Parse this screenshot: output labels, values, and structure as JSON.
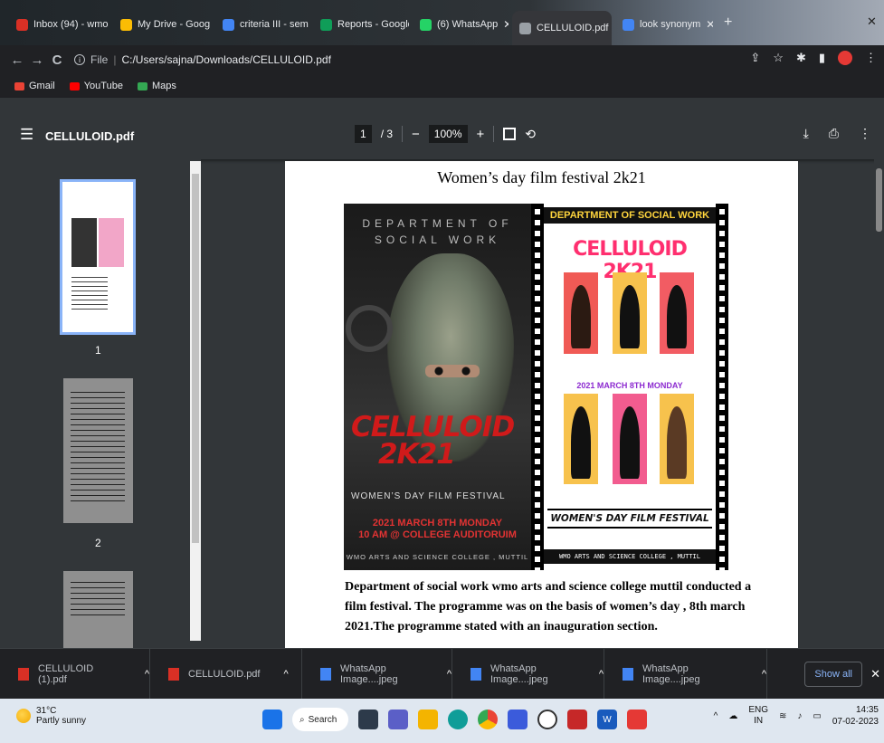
{
  "tabs": [
    {
      "label": "Inbox (94) - wmo",
      "fav": "#d93025",
      "x": true
    },
    {
      "label": "My Drive - Goog",
      "fav": "#fbbc04",
      "x": true
    },
    {
      "label": "criteria III - sem",
      "fav": "#4285f4",
      "x": true
    },
    {
      "label": "Reports - Google",
      "fav": "#0f9d58",
      "x": true
    },
    {
      "label": "(6) WhatsApp",
      "fav": "#25d366",
      "x": true
    },
    {
      "label": "CELLULOID.pdf",
      "fav": "#9aa0a6",
      "x": true,
      "active": true
    },
    {
      "label": "look synonym",
      "fav": "#4285f4",
      "x": true
    }
  ],
  "address": {
    "scheme": "File",
    "path": "C:/Users/sajna/Downloads/CELLULOID.pdf"
  },
  "bookmarks": [
    {
      "label": "Gmail",
      "color": "#ea4335"
    },
    {
      "label": "YouTube",
      "color": "#ff0000"
    },
    {
      "label": "Maps",
      "color": "#34a853"
    }
  ],
  "viewer": {
    "title": "CELLULOID.pdf",
    "page_current": "1",
    "page_total": "/ 3",
    "zoom": "100%",
    "zoom_minus": "−",
    "zoom_plus": "+"
  },
  "thumbnails": [
    {
      "label": "1"
    },
    {
      "label": "2"
    }
  ],
  "doc": {
    "heading": "Women’s day film festival 2k21",
    "paragraph": "Department of social work wmo arts and science college muttil conducted a film festival. The programme was on the basis of women’s day  , 8th march 2021.The programme stated with an inauguration section."
  },
  "poster_left": {
    "dept_line1": "DEPARTMENT OF",
    "dept_line2": "SOCIAL WORK",
    "title_line1": "CELLULOID",
    "title_line2": "2K21",
    "subtitle": "WOMEN’S DAY FILM FESTIVAL",
    "date_line1": "2021 MARCH 8TH MONDAY",
    "date_line2": "10 AM @ COLLEGE AUDITORUIM",
    "college": "WMO ARTS AND SCIENCE COLLEGE , MUTTIL"
  },
  "poster_right": {
    "header": "DEPARTMENT OF SOCIAL WORK",
    "title": "CELLULOID 2K21",
    "date": "2021 MARCH 8TH MONDAY",
    "festival": "WOMEN'S DAY FILM FESTIVAL",
    "college": "WMO ARTS AND SCIENCE COLLEGE , MUTTIL"
  },
  "downloads": [
    {
      "label": "CELLULOID (1).pdf",
      "icon": "pdf-icon",
      "color": "#d93025"
    },
    {
      "label": "CELLULOID.pdf",
      "icon": "pdf-icon",
      "color": "#d93025"
    },
    {
      "label": "WhatsApp Image....jpeg",
      "icon": "image-icon",
      "color": "#4285f4"
    },
    {
      "label": "WhatsApp Image....jpeg",
      "icon": "image-icon",
      "color": "#4285f4"
    },
    {
      "label": "WhatsApp Image....jpeg",
      "icon": "image-icon",
      "color": "#4285f4"
    }
  ],
  "show_all": "Show all",
  "taskbar": {
    "temp": "31°C",
    "weather": "Partly sunny",
    "search": "Search",
    "lang1": "ENG",
    "lang2": "IN",
    "time": "14:35",
    "date": "07-02-2023"
  }
}
